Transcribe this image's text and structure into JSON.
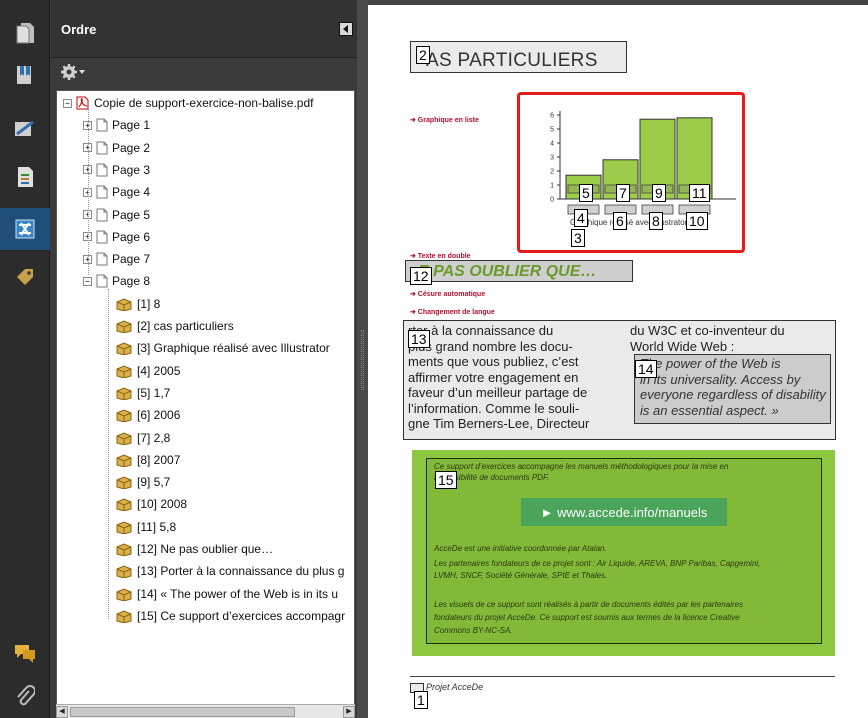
{
  "panel": {
    "title": "Ordre"
  },
  "tree": {
    "root": "Copie de support-exercice-non-balise.pdf",
    "pages": [
      "Page 1",
      "Page 2",
      "Page 3",
      "Page 4",
      "Page 5",
      "Page 6",
      "Page 7",
      "Page 8"
    ],
    "tags": [
      "[1] 8",
      "[2] cas particuliers",
      "[3] Graphique réalisé avec Illustrator",
      "[4] 2005",
      "[5] 1,7",
      "[6] 2006",
      "[7] 2,8",
      "[8] 2007",
      "[9] 5,7",
      "[10] 2008",
      "[11] 5,8",
      "[12] Ne pas oublier que…",
      "[13] Porter à la connaissance du plus g",
      "[14] « The power of the Web is in its u",
      "[15] Ce support d’exercices accompagr"
    ]
  },
  "doc": {
    "heading": "AS PARTICULIERS",
    "labels": {
      "graph": "➔ Graphique en liste",
      "double": "➔ Texte en double",
      "cesure": "➔ Césure automatique",
      "langue": "➔ Changement de langue"
    },
    "chart_caption": "Graphique réalisé avec Illustrator",
    "callout": "E PAS OUBLIER QUE…",
    "col1": [
      "rter à la connaissance du",
      "plus grand nombre les docu-",
      "ments que vous publiez, c’est",
      "affirmer votre engagement en",
      "faveur d’un meilleur partage de",
      "l’information. Comme le souli-",
      "gne Tim Berners-Lee, Directeur"
    ],
    "col2": [
      "du W3C et co-inventeur du",
      "World Wide Web :"
    ],
    "quote": [
      "The power of the Web is",
      "in its universality. Access by",
      "everyone regardless of disability",
      "is an essential aspect. »"
    ],
    "green": {
      "intro": [
        "Ce support d’exercices accompagne les manuels méthodologiques pour la mise en",
        "accessibilité de documents PDF."
      ],
      "link": "► www.accede.info/manuels",
      "p1": "AcceDe est une initiative coordonnée par Atalan.",
      "p2": [
        "Les partenaires fondateurs de ce projet sont : Air Liquide, AREVA, BNP Paribas, Capgemini,",
        "LVMH, SNCF, Société Générale, SPIE et Thales."
      ],
      "p3": [
        "Les visuels de ce support sont réalisés à partir de documents édités par les partenaires",
        "fondateurs du projet AcceDe. Ce support est soumis aux termes de la licence Creative",
        "Commons BY-NC-SA."
      ]
    },
    "footer": "Projet AcceDe",
    "box_numbers": [
      "1",
      "2",
      "3",
      "4",
      "5",
      "6",
      "7",
      "8",
      "9",
      "10",
      "11",
      "12",
      "13",
      "14",
      "15"
    ],
    "chart_ticks": [
      "0",
      "1",
      "2",
      "3",
      "4",
      "5",
      "6"
    ]
  },
  "chart_data": {
    "type": "bar",
    "categories": [
      "2005",
      "2006",
      "2007",
      "2008"
    ],
    "values": [
      1.7,
      2.8,
      5.7,
      5.8
    ],
    "ylim": [
      0,
      6
    ],
    "color": "#9ccc4a"
  },
  "colors": {
    "accent": "#1f4f78",
    "green_bg": "#8dc63f",
    "link_bg": "#4aa45a",
    "chart_border": "#e31b1b"
  }
}
